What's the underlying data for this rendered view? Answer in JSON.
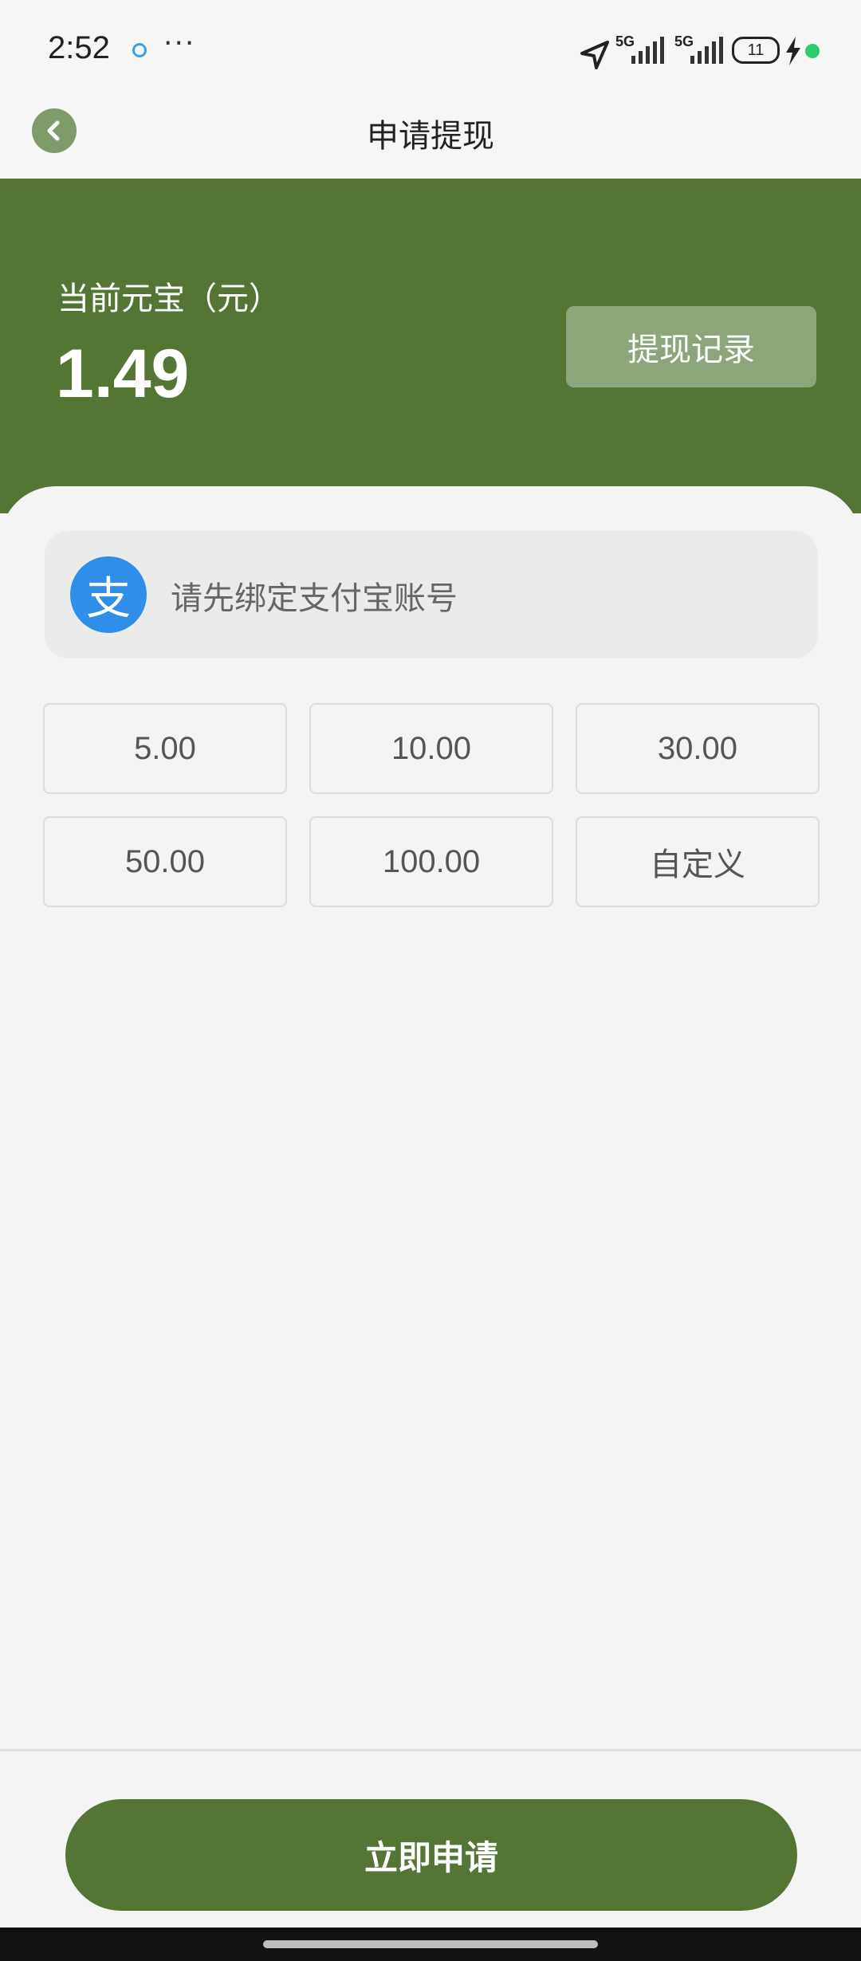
{
  "status_bar": {
    "time": "2:52",
    "more": "···",
    "signal1_label": "5G",
    "signal2_label": "5G",
    "battery": "11",
    "battery_dot_color": "#2ecc71"
  },
  "nav": {
    "title": "申请提现",
    "back_icon": "chevron-left-icon"
  },
  "header": {
    "balance_label": "当前元宝（元）",
    "balance_value": "1.49",
    "record_button": "提现记录",
    "bg_color": "#557534"
  },
  "account": {
    "icon": "alipay-icon",
    "icon_glyph": "支",
    "placeholder": "请先绑定支付宝账号"
  },
  "amounts": [
    "5.00",
    "10.00",
    "30.00",
    "50.00",
    "100.00",
    "自定义"
  ],
  "footer": {
    "apply_button": "立即申请"
  }
}
